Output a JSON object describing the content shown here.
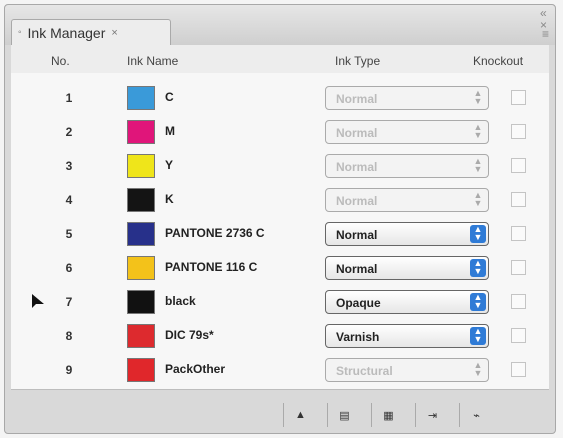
{
  "panel": {
    "tab_label": "Ink Manager",
    "tab_dot_icon": "circle-dot",
    "tab_close_glyph": "×",
    "collapse_glyph": "«",
    "close_glyph": "×",
    "menu_glyph": "≡"
  },
  "columns": {
    "no": "No.",
    "ink_name": "Ink Name",
    "ink_type": "Ink Type",
    "knockout": "Knockout"
  },
  "inks": [
    {
      "no": "1",
      "name": "C",
      "color": "#3a9ad9",
      "type": "Normal",
      "enabled": false,
      "knockout": false
    },
    {
      "no": "2",
      "name": "M",
      "color": "#e0157a",
      "type": "Normal",
      "enabled": false,
      "knockout": false
    },
    {
      "no": "3",
      "name": "Y",
      "color": "#efe51a",
      "type": "Normal",
      "enabled": false,
      "knockout": false
    },
    {
      "no": "4",
      "name": "K",
      "color": "#141414",
      "type": "Normal",
      "enabled": false,
      "knockout": false
    },
    {
      "no": "5",
      "name": "PANTONE 2736 C",
      "color": "#27308a",
      "type": "Normal",
      "enabled": true,
      "knockout": false
    },
    {
      "no": "6",
      "name": "PANTONE 116 C",
      "color": "#f3c21a",
      "type": "Normal",
      "enabled": true,
      "knockout": false
    },
    {
      "no": "7",
      "name": "black",
      "color": "#111111",
      "type": "Opaque",
      "enabled": true,
      "knockout": false,
      "selected_arrow": true
    },
    {
      "no": "8",
      "name": "DIC 79s*",
      "color": "#dd2a2e",
      "type": "Varnish",
      "enabled": true,
      "knockout": false
    },
    {
      "no": "9",
      "name": "PackOther",
      "color": "#e0272b",
      "type": "Structural",
      "enabled": false,
      "knockout": false
    }
  ],
  "footer_buttons": [
    {
      "icon": "move-up-arrow-icon",
      "glyph": "▲"
    },
    {
      "icon": "sort-icon",
      "glyph": "▤"
    },
    {
      "icon": "select-ink-icon",
      "glyph": "▦"
    },
    {
      "icon": "merge-ink-icon",
      "glyph": "⇥"
    },
    {
      "icon": "link-icon",
      "glyph": "⌁"
    }
  ]
}
